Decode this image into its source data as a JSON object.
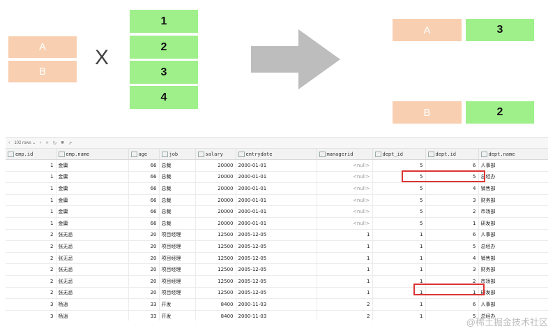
{
  "left_set": {
    "items": [
      "A",
      "B"
    ]
  },
  "cross_symbol": "X",
  "right_set": {
    "items": [
      "1",
      "2",
      "3",
      "4"
    ]
  },
  "result": {
    "rows": [
      {
        "left": "A",
        "right": "3"
      },
      {
        "left": "B",
        "right": "2"
      }
    ]
  },
  "grid": {
    "toolbar": {
      "rows_label": "102 rows"
    },
    "columns": [
      "emp.id",
      "emp.name",
      "age",
      "job",
      "salary",
      "entrydate",
      "managerid",
      "dept_id",
      "dept.id",
      "dept.name"
    ],
    "rows": [
      [
        "1",
        "金庸",
        "66",
        "总裁",
        "20000",
        "2000-01-01",
        "<null>",
        "5",
        "6",
        "人事部"
      ],
      [
        "1",
        "金庸",
        "66",
        "总裁",
        "20000",
        "2000-01-01",
        "<null>",
        "5",
        "5",
        "总经办"
      ],
      [
        "1",
        "金庸",
        "66",
        "总裁",
        "20000",
        "2000-01-01",
        "<null>",
        "5",
        "4",
        "销售部"
      ],
      [
        "1",
        "金庸",
        "66",
        "总裁",
        "20000",
        "2000-01-01",
        "<null>",
        "5",
        "3",
        "财务部"
      ],
      [
        "1",
        "金庸",
        "66",
        "总裁",
        "20000",
        "2000-01-01",
        "<null>",
        "5",
        "2",
        "市场部"
      ],
      [
        "1",
        "金庸",
        "66",
        "总裁",
        "20000",
        "2000-01-01",
        "<null>",
        "5",
        "1",
        "研发部"
      ],
      [
        "2",
        "张无忌",
        "20",
        "项目经理",
        "12500",
        "2005-12-05",
        "1",
        "1",
        "6",
        "人事部"
      ],
      [
        "2",
        "张无忌",
        "20",
        "项目经理",
        "12500",
        "2005-12-05",
        "1",
        "1",
        "5",
        "总经办"
      ],
      [
        "2",
        "张无忌",
        "20",
        "项目经理",
        "12500",
        "2005-12-05",
        "1",
        "1",
        "4",
        "销售部"
      ],
      [
        "2",
        "张无忌",
        "20",
        "项目经理",
        "12500",
        "2005-12-05",
        "1",
        "1",
        "3",
        "财务部"
      ],
      [
        "2",
        "张无忌",
        "20",
        "项目经理",
        "12500",
        "2005-12-05",
        "1",
        "1",
        "2",
        "市场部"
      ],
      [
        "2",
        "张无忌",
        "20",
        "项目经理",
        "12500",
        "2005-12-05",
        "1",
        "1",
        "1",
        "研发部"
      ],
      [
        "3",
        "杨逍",
        "33",
        "开发",
        "8400",
        "2000-11-03",
        "2",
        "1",
        "6",
        "人事部"
      ],
      [
        "3",
        "杨逍",
        "33",
        "开发",
        "8400",
        "2000-11-03",
        "2",
        "1",
        "5",
        "总经办"
      ]
    ]
  },
  "watermark": "@稀土掘金技术社区"
}
